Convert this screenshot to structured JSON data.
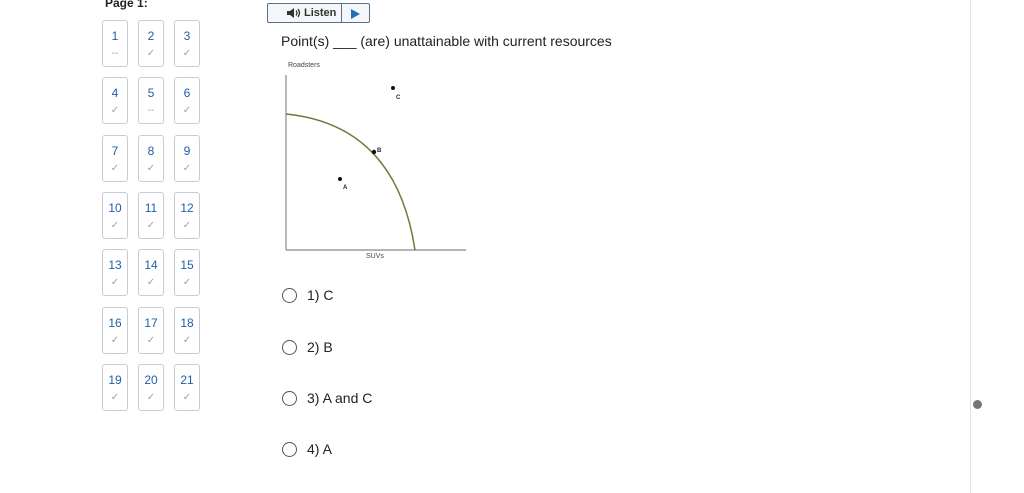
{
  "page": {
    "label": "Page 1:"
  },
  "questions": [
    {
      "num": "1",
      "status": "--"
    },
    {
      "num": "2",
      "status": "✓"
    },
    {
      "num": "3",
      "status": "✓"
    },
    {
      "num": "4",
      "status": "✓"
    },
    {
      "num": "5",
      "status": "--"
    },
    {
      "num": "6",
      "status": "✓"
    },
    {
      "num": "7",
      "status": "✓"
    },
    {
      "num": "8",
      "status": "✓"
    },
    {
      "num": "9",
      "status": "✓"
    },
    {
      "num": "10",
      "status": "✓"
    },
    {
      "num": "11",
      "status": "✓"
    },
    {
      "num": "12",
      "status": "✓"
    },
    {
      "num": "13",
      "status": "✓"
    },
    {
      "num": "14",
      "status": "✓"
    },
    {
      "num": "15",
      "status": "✓"
    },
    {
      "num": "16",
      "status": "✓"
    },
    {
      "num": "17",
      "status": "✓"
    },
    {
      "num": "18",
      "status": "✓"
    },
    {
      "num": "19",
      "status": "✓"
    },
    {
      "num": "20",
      "status": "✓"
    },
    {
      "num": "21",
      "status": "✓"
    }
  ],
  "listen": {
    "label": "Listen",
    "speaker_icon": "speaker-icon",
    "play_icon": "play-icon"
  },
  "question": {
    "text": "Point(s) ___ (are) unattainable with current resources"
  },
  "graph": {
    "y_axis_label": "Roadsters",
    "x_axis_label": "SUVs",
    "points": [
      {
        "label": "A"
      },
      {
        "label": "B"
      },
      {
        "label": "C"
      }
    ],
    "curve_color": "#6b7f3a"
  },
  "options": [
    {
      "text": "1)  C"
    },
    {
      "text": "2)  B"
    },
    {
      "text": "3)  A and C"
    },
    {
      "text": "4)  A"
    }
  ]
}
